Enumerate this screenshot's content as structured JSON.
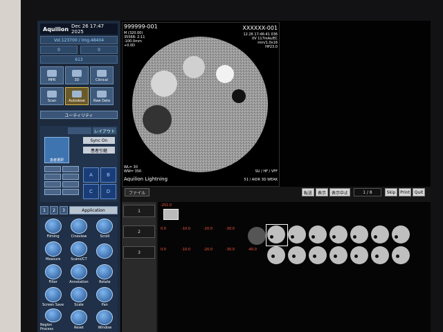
{
  "header": {
    "brand": "Aquilion",
    "datetime": "Dec 26 17:47 2025"
  },
  "sidebar": {
    "vol": "Vol.123700 / Img.48404",
    "fields": [
      "0",
      "0"
    ],
    "count": "613",
    "tiles_row1": [
      "MPR",
      "3D",
      "Clinical"
    ],
    "tiles_row2": [
      "Scan",
      "Autodose",
      "Raw Data"
    ],
    "utility": "ユーティリティ",
    "section_tabs": [
      "",
      "レイアウト"
    ],
    "patient_button": "患者選択",
    "sync": "Sync On",
    "series_button": "患者引継",
    "quad": [
      "A",
      "B",
      "C",
      "D"
    ],
    "app_tabs": [
      "1",
      "2",
      "3"
    ],
    "app_tab_active": "Application",
    "apps": [
      "Filming",
      "Cineview",
      "Scroll",
      "Measure",
      "Scano/CT",
      "",
      "Filter",
      "Annotation",
      "Rotate",
      "Screen Save",
      "Scale",
      "Pan",
      "Region Process",
      "Reset",
      "Window"
    ]
  },
  "viewport": {
    "patient_id": "999999-001",
    "right_id": "XXXXXX-001",
    "line2": "M (320.00)",
    "line3": "35568: 2:11",
    "line4": "-100.0mm",
    "line5": "+0.0D",
    "r2": "12.26 17:46:41 036",
    "r3": "0V 117mAs/EC",
    "r4": "mm/1.0x16",
    "r5": "HP23.0",
    "wl": "WL= 30",
    "ww": "WW= 350",
    "bottom_left": "Aquilion Lightning",
    "bottom_right": "SU / HF / VFF",
    "bottom_right2": "51 / AIDR 3D WEAK"
  },
  "browser": {
    "file_tab": "ファイル",
    "toolbar": [
      "転送",
      "表示",
      "表示中止"
    ],
    "page": "1 / 8",
    "skip": "Skip",
    "print": "Print",
    "quit": "Quit",
    "rows": [
      "1",
      "2",
      "3"
    ],
    "row1_label": "-251.0",
    "row2_labels": [
      "0.0",
      "-10.0",
      "-20.0",
      "-30.0",
      "",
      "",
      "",
      "",
      "",
      "",
      "",
      ""
    ],
    "row3_labels": [
      "0.0",
      "-10.0",
      "-20.0",
      "-30.0",
      "-40.0"
    ]
  }
}
